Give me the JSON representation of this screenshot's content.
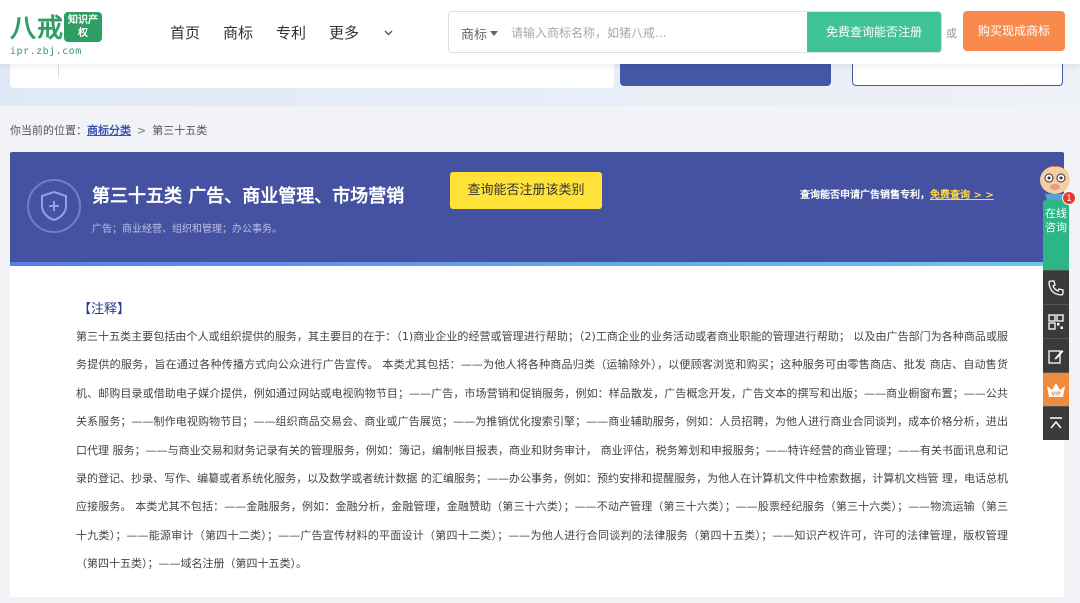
{
  "header": {
    "logo_text": "八戒",
    "logo_badge": "知识产权",
    "logo_url": "ipr.zbj.com",
    "nav": [
      "首页",
      "商标",
      "专利",
      "更多"
    ],
    "search": {
      "category": "商标",
      "placeholder": "请输入商标名称，如猪八戒...",
      "query_button": "免费查询能否注册"
    },
    "or_text": "或",
    "buy_button": "购买现成商标"
  },
  "breadcrumb": {
    "prefix": "你当前的位置：",
    "link": "商标分类",
    "separator": ">",
    "current": "第三十五类"
  },
  "banner": {
    "title": "第三十五类 广告、商业管理、市场营销",
    "subtitle": "广告；商业经营、组织和管理；办公事务。",
    "check_button": "查询能否注册该类别",
    "right_text": "查询能否申请广告销售专利，",
    "right_link": "免费查询 > >"
  },
  "content": {
    "note_heading": "【注释】",
    "note_body": "第三十五类主要包括由个人或组织提供的服务，其主要目的在于：（1)商业企业的经营或管理进行帮助；（2)工商企业的业务活动或者商业职能的管理进行帮助； 以及由广告部门为各种商品或服务提供的服务，旨在通过各种传播方式向公众进行广告宣传。 本类尤其包括：——为他人将各种商品归类（运输除外），以便顾客浏览和购买；这种服务可由零售商店、批发 商店、自动售货机、邮购目录或借助电子媒介提供，例如通过网站或电视购物节目；——广告，市场营销和促销服务，例如：样品散发，广告概念开发，广告文本的撰写和出版；——商业橱窗布置；——公共关系服务；——制作电视购物节目；——组织商品交易会、商业或广告展览；——为推销优化搜索引擎；——商业辅助服务，例如：人员招聘，为他人进行商业合同谈判，成本价格分析，进出口代理 服务；——与商业交易和财务记录有关的管理服务，例如：簿记，编制帐目报表，商业和财务审计， 商业评估，税务筹划和申报服务；——特许经营的商业管理；——有关书面讯息和记录的登记、抄录、写作、编纂或者系统化服务，以及数学或者统计数据 的汇编服务；——办公事务，例如：预约安排和提醒服务，为他人在计算机文件中检索数据，计算机文档管 理，电话总机应接服务。 本类尤其不包括：——金融服务，例如：金融分析，金融管理，金融赞助（第三十六类）；——不动产管理（第三十六类）；——股票经纪服务（第三十六类）；——物流运输（第三十九类）；——能源审计（第四十二类）；——广告宣传材料的平面设计（第四十二类）；——为他人进行合同谈判的法律服务（第四十五类）；——知识产权许可，许可的法律管理，版权管理（第四十五类）；——域名注册（第四十五类）。"
  },
  "side_panel": {
    "online_label": "在线咨询",
    "badge_count": "1",
    "icons": [
      "phone-icon",
      "qrcode-icon",
      "edit-icon",
      "vip-icon",
      "back-to-top-icon"
    ]
  },
  "colors": {
    "brand_green": "#2f9e62",
    "query_green": "#41c398",
    "buy_orange": "#f98a4e",
    "banner_blue": "#4552a1",
    "yellow_button": "#ffe339"
  }
}
